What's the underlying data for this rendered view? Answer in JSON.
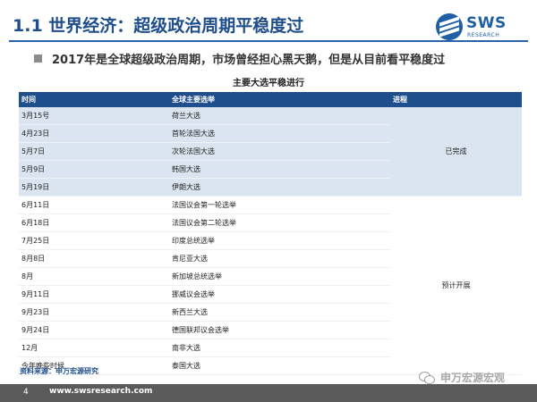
{
  "header": {
    "title": "1.1 世界经济：超级政治周期平稳度过",
    "logo_name": "SWS",
    "logo_sub": "RESEARCH"
  },
  "subtitle": "2017年是全球超级政治周期，市场曾经担心黑天鹅，但是从目前看平稳度过",
  "table": {
    "title": "主要大选平稳进行",
    "columns": [
      "时间",
      "全球主要选举",
      "进程"
    ],
    "rows": [
      {
        "date": "3月15号",
        "election": "荷兰大选"
      },
      {
        "date": "4月23日",
        "election": "首轮法国大选"
      },
      {
        "date": "5月7日",
        "election": "次轮法国大选"
      },
      {
        "date": "5月9日",
        "election": "韩国大选"
      },
      {
        "date": "5月19日",
        "election": "伊朗大选"
      },
      {
        "date": "6月11日",
        "election": "法国议会第一轮选举"
      },
      {
        "date": "6月18日",
        "election": "法国议会第二轮选举"
      },
      {
        "date": "7月25日",
        "election": "印度总统选举"
      },
      {
        "date": "8月8日",
        "election": "肯尼亚大选"
      },
      {
        "date": "8月",
        "election": "新加坡总统选举"
      },
      {
        "date": "9月11日",
        "election": "挪威议会选举"
      },
      {
        "date": "9月23日",
        "election": "新西兰大选"
      },
      {
        "date": "9月24日",
        "election": "德国联邦议会选举"
      },
      {
        "date": "12月",
        "election": "南非大选"
      },
      {
        "date": "今年晚些时候",
        "election": "泰国大选"
      }
    ],
    "status_done": "已完成",
    "status_expected": "预计开展"
  },
  "source": "资料来源：申万宏源研究",
  "footer": {
    "page": "4",
    "url": "www.swsresearch.com"
  },
  "watermark": "申万宏源宏观",
  "colors": {
    "brand": "#1f4e8c",
    "row_done": "#dbe5f1",
    "footer": "#5a5a5a"
  }
}
